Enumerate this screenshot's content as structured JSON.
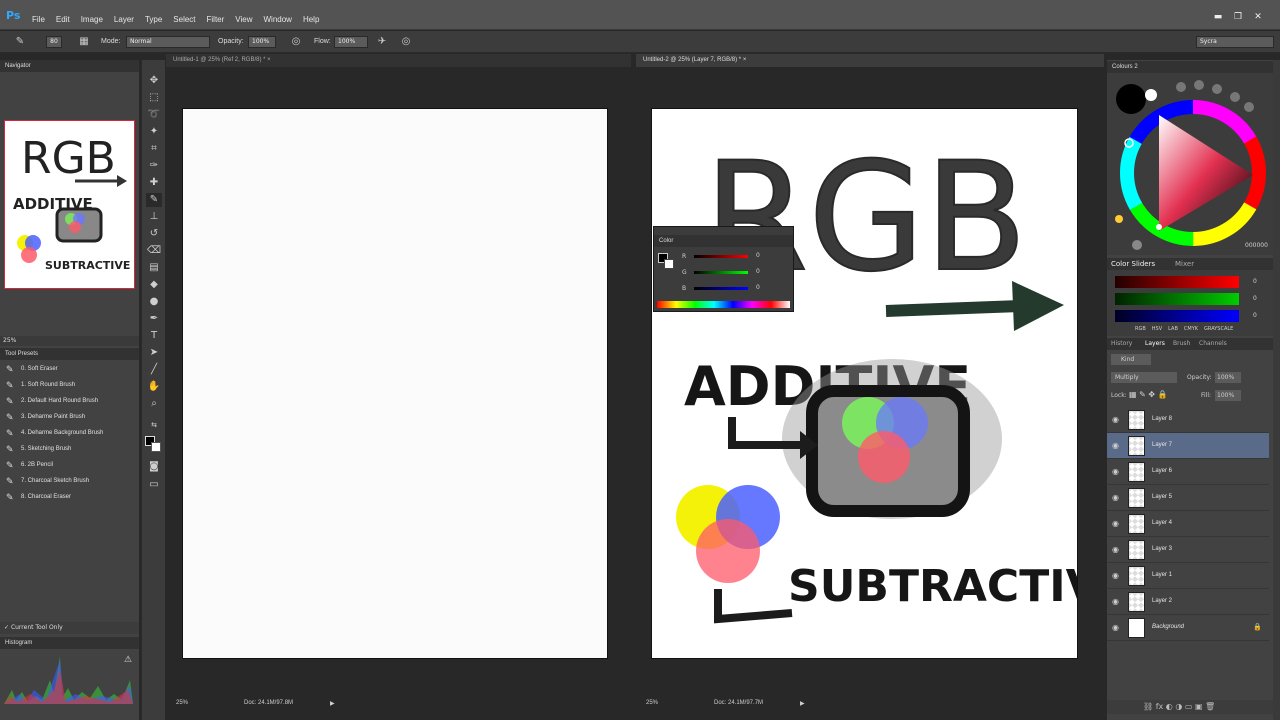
{
  "app": {
    "logo": "Ps"
  },
  "menu": [
    "File",
    "Edit",
    "Image",
    "Layer",
    "Type",
    "Select",
    "Filter",
    "View",
    "Window",
    "Help"
  ],
  "window_controls": {
    "minimize": "▬",
    "restore": "❐",
    "close": "✕"
  },
  "options": {
    "size": "80",
    "mode_label": "Mode:",
    "mode_value": "Normal",
    "opacity_label": "Opacity:",
    "opacity_value": "100%",
    "flow_label": "Flow:",
    "flow_value": "100%",
    "workspace": "Sycra"
  },
  "tabs": {
    "doc1": "Untitled-1 @ 25% (Ref 2, RGB/8) *",
    "doc2": "Untitled-2 @ 25% (Layer 7, RGB/8) *",
    "close": "×"
  },
  "navigator": {
    "title": "Navigator",
    "zoom": "25%"
  },
  "tool_presets": {
    "title": "Tool Presets",
    "items": [
      "0. Soft Eraser",
      "1. Soft Round Brush",
      "2. Default Hard Round Brush",
      "3. Deharme Paint Brush",
      "4. Deharme Background Brush",
      "5. Sketching Brush",
      "6. 2B Pencil",
      "7. Charcoal Sketch Brush",
      "8. Charcoal Eraser"
    ],
    "current_tool_only": "Current Tool Only"
  },
  "histogram": {
    "title": "Histogram"
  },
  "status": {
    "doc1_zoom": "25%",
    "doc1_info": "Doc: 24.1M/97.8M",
    "doc2_zoom": "25%",
    "doc2_info": "Doc: 24.1M/97.7M"
  },
  "color_panel": {
    "title": "Color",
    "r_label": "R",
    "g_label": "G",
    "b_label": "B",
    "r": "0",
    "g": "0",
    "b": "0"
  },
  "colours2": {
    "title": "Colours 2",
    "hex": "000000"
  },
  "color_sliders": {
    "tab1": "Color Sliders",
    "tab2": "Mixer",
    "r": "0",
    "g": "0",
    "b": "0",
    "modes": [
      "RGB",
      "HSV",
      "LAB",
      "CMYK",
      "GRAYSCALE"
    ]
  },
  "layers_panel": {
    "tabs": [
      "History",
      "Layers",
      "Brush",
      "Channels"
    ],
    "kind": "Kind",
    "blend": "Multiply",
    "opacity_label": "Opacity:",
    "opacity": "100%",
    "lock_label": "Lock:",
    "fill_label": "Fill:",
    "fill": "100%",
    "layers": [
      "Layer 8",
      "Layer 7",
      "Layer 6",
      "Layer 5",
      "Layer 4",
      "Layer 3",
      "Layer 1",
      "Layer 2",
      "Background"
    ],
    "selected": "Layer 7"
  },
  "artwork": {
    "title": "RGB",
    "word1": "ADDITIVE",
    "word2": "SUBTRACTIVE",
    "colors": {
      "red": "#ff5a6a",
      "green": "#7af25a",
      "blue": "#6a78ff",
      "yellow": "#f5f20a",
      "gray": "#8a8a8a"
    }
  }
}
